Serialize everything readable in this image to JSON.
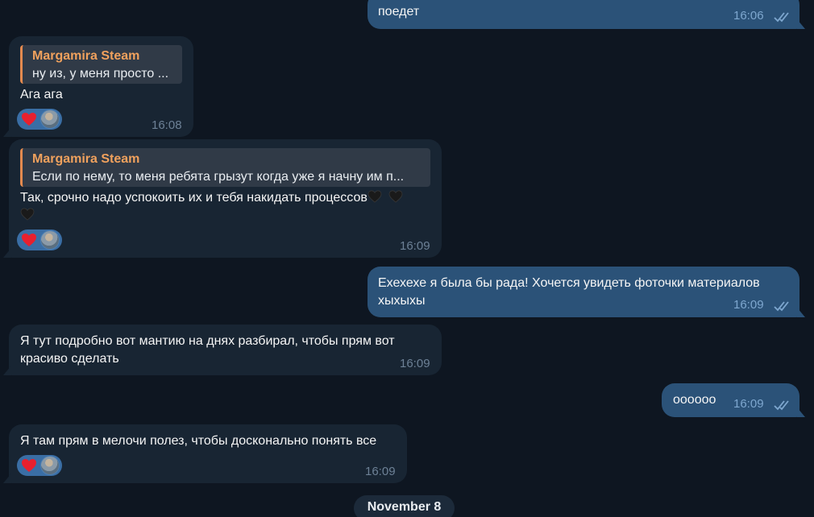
{
  "messages": {
    "m0": {
      "text": "поедет",
      "time": "16:06"
    },
    "m1": {
      "quote_author": "Margamira Steam",
      "quote_text": "ну из, у меня просто ...",
      "text": "Ага ага",
      "time": "16:08"
    },
    "m2": {
      "quote_author": "Margamira Steam",
      "quote_text": "Если по нему, то меня ребята грызут когда уже я начну им п...",
      "text_line1": "Так, срочно надо успокоить их и тебя накидать процессов",
      "time": "16:09"
    },
    "m3": {
      "line1": "Ехехехе я была бы рада! Хочется увидеть фоточки материалов",
      "line2": "хыхыхы",
      "time": "16:09"
    },
    "m4": {
      "line1": "Я тут подробно вот мантию на днях разбирал, чтобы прям вот",
      "line2": "красиво сделать",
      "time": "16:09"
    },
    "m5": {
      "text": "оооооо",
      "time": "16:09"
    },
    "m6": {
      "text": "Я там прям в мелочи полез, чтобы досконально понять все",
      "time": "16:09"
    }
  },
  "date_separator": "November 8",
  "colors": {
    "background": "#0e1621",
    "incoming_bubble": "#182533",
    "outgoing_bubble": "#2b5278",
    "quote_accent": "#e48a4f",
    "reaction_bg": "#3a6ea5"
  },
  "icons": {
    "read_receipt": "double-check-icon",
    "reaction": "red-heart-icon",
    "inline_emoji": "black-heart-icon"
  }
}
